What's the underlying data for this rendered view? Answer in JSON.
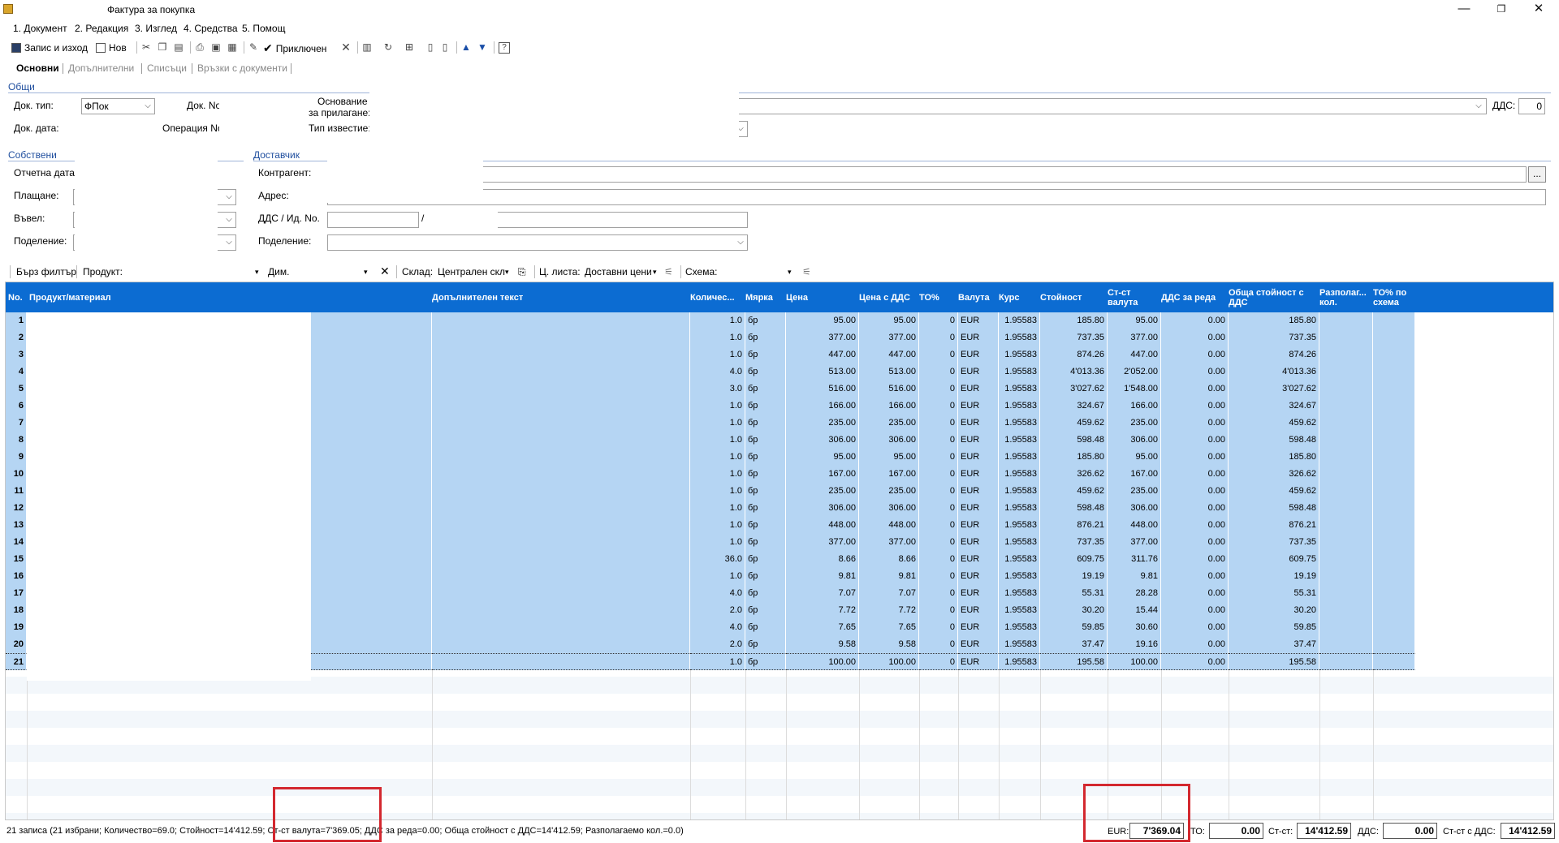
{
  "window": {
    "title": "Фактура за покупка",
    "minimize": "—",
    "restore": "❐",
    "close": "✕"
  },
  "menu": [
    "1. Документ",
    "2. Редакция",
    "3. Изглед",
    "4. Средства",
    "5. Помощ"
  ],
  "toolbar": {
    "save_exit": "Запис и изход",
    "new": "Нов",
    "finished": "Приключен"
  },
  "tabs": [
    "Основни",
    "Допълнителни",
    "Списъци",
    "Връзки с документи"
  ],
  "form": {
    "general_section": "Общи",
    "doc_type_label": "Док. тип:",
    "doc_type_value": "ФПок",
    "doc_no_label": "Док. No",
    "basis_label_1": "Основание",
    "basis_label_2": "за прилагане:",
    "vat_label": "ДДС:",
    "vat_value": "0",
    "doc_date_label": "Док. дата:",
    "operation_label": "Операция No",
    "notice_type_label": "Тип известие:",
    "own_section": "Собствени",
    "report_date_label": "Отчетна дата:",
    "payment_label": "Плащане:",
    "entered_label": "Въвел:",
    "division_label": "Поделение:",
    "supplier_section": "Доставчик",
    "counterparty_label": "Контрагент:",
    "address_label": "Адрес:",
    "vat_id_label": "ДДС / Ид. No.",
    "vat_id_sep": "/",
    "supplier_division_label": "Поделение:",
    "browse": "..."
  },
  "filter": {
    "quick": "Бърз филтър",
    "product": "Продукт:",
    "dim": "Дим.",
    "warehouse": "Склад:",
    "warehouse_value": "Централен скл",
    "price_list": "Ц. листа:",
    "price_list_value": "Доставни цени",
    "scheme": "Схема:"
  },
  "grid": {
    "headers": [
      "No.",
      "Продукт/материал",
      "Допълнителен текст",
      "Количес...",
      "Мярка",
      "Цена",
      "Цена с ДДС",
      "ТО%",
      "Валута",
      "Курс",
      "Стойност",
      "Ст-ст валута",
      "ДДС за реда",
      "Обща стойност с ДДС",
      "Разполаг... кол.",
      "ТО% по схема"
    ],
    "rows": [
      [
        "1",
        "1.0",
        "бр",
        "95.00",
        "95.00",
        "0",
        "EUR",
        "1.95583",
        "185.80",
        "95.00",
        "0.00",
        "185.80"
      ],
      [
        "2",
        "1.0",
        "бр",
        "377.00",
        "377.00",
        "0",
        "EUR",
        "1.95583",
        "737.35",
        "377.00",
        "0.00",
        "737.35"
      ],
      [
        "3",
        "1.0",
        "бр",
        "447.00",
        "447.00",
        "0",
        "EUR",
        "1.95583",
        "874.26",
        "447.00",
        "0.00",
        "874.26"
      ],
      [
        "4",
        "4.0",
        "бр",
        "513.00",
        "513.00",
        "0",
        "EUR",
        "1.95583",
        "4'013.36",
        "2'052.00",
        "0.00",
        "4'013.36"
      ],
      [
        "5",
        "3.0",
        "бр",
        "516.00",
        "516.00",
        "0",
        "EUR",
        "1.95583",
        "3'027.62",
        "1'548.00",
        "0.00",
        "3'027.62"
      ],
      [
        "6",
        "1.0",
        "бр",
        "166.00",
        "166.00",
        "0",
        "EUR",
        "1.95583",
        "324.67",
        "166.00",
        "0.00",
        "324.67"
      ],
      [
        "7",
        "1.0",
        "бр",
        "235.00",
        "235.00",
        "0",
        "EUR",
        "1.95583",
        "459.62",
        "235.00",
        "0.00",
        "459.62"
      ],
      [
        "8",
        "1.0",
        "бр",
        "306.00",
        "306.00",
        "0",
        "EUR",
        "1.95583",
        "598.48",
        "306.00",
        "0.00",
        "598.48"
      ],
      [
        "9",
        "1.0",
        "бр",
        "95.00",
        "95.00",
        "0",
        "EUR",
        "1.95583",
        "185.80",
        "95.00",
        "0.00",
        "185.80"
      ],
      [
        "10",
        "1.0",
        "бр",
        "167.00",
        "167.00",
        "0",
        "EUR",
        "1.95583",
        "326.62",
        "167.00",
        "0.00",
        "326.62"
      ],
      [
        "11",
        "1.0",
        "бр",
        "235.00",
        "235.00",
        "0",
        "EUR",
        "1.95583",
        "459.62",
        "235.00",
        "0.00",
        "459.62"
      ],
      [
        "12",
        "1.0",
        "бр",
        "306.00",
        "306.00",
        "0",
        "EUR",
        "1.95583",
        "598.48",
        "306.00",
        "0.00",
        "598.48"
      ],
      [
        "13",
        "1.0",
        "бр",
        "448.00",
        "448.00",
        "0",
        "EUR",
        "1.95583",
        "876.21",
        "448.00",
        "0.00",
        "876.21"
      ],
      [
        "14",
        "1.0",
        "бр",
        "377.00",
        "377.00",
        "0",
        "EUR",
        "1.95583",
        "737.35",
        "377.00",
        "0.00",
        "737.35"
      ],
      [
        "15",
        "36.0",
        "бр",
        "8.66",
        "8.66",
        "0",
        "EUR",
        "1.95583",
        "609.75",
        "311.76",
        "0.00",
        "609.75"
      ],
      [
        "16",
        "1.0",
        "бр",
        "9.81",
        "9.81",
        "0",
        "EUR",
        "1.95583",
        "19.19",
        "9.81",
        "0.00",
        "19.19"
      ],
      [
        "17",
        "4.0",
        "бр",
        "7.07",
        "7.07",
        "0",
        "EUR",
        "1.95583",
        "55.31",
        "28.28",
        "0.00",
        "55.31"
      ],
      [
        "18",
        "2.0",
        "бр",
        "7.72",
        "7.72",
        "0",
        "EUR",
        "1.95583",
        "30.20",
        "15.44",
        "0.00",
        "30.20"
      ],
      [
        "19",
        "4.0",
        "бр",
        "7.65",
        "7.65",
        "0",
        "EUR",
        "1.95583",
        "59.85",
        "30.60",
        "0.00",
        "59.85"
      ],
      [
        "20",
        "2.0",
        "бр",
        "9.58",
        "9.58",
        "0",
        "EUR",
        "1.95583",
        "37.47",
        "19.16",
        "0.00",
        "37.47"
      ],
      [
        "21",
        "1.0",
        "бр",
        "100.00",
        "100.00",
        "0",
        "EUR",
        "1.95583",
        "195.58",
        "100.00",
        "0.00",
        "195.58"
      ]
    ]
  },
  "status": {
    "summary": "21 записа (21 избрани; Количество=69.0; Стойност=14'412.59; Ст-ст валута=7'369.05; ДДС за реда=0.00; Обща стойност с ДДС=14'412.59; Разполагаемо кол.=0.0)",
    "eur_label": "EUR:",
    "eur_value": "7'369.04",
    "to_label": "ТО:",
    "to_value": "0.00",
    "value_label": "Ст-ст:",
    "value_value": "14'412.59",
    "vat_label": "ДДС:",
    "vat_value": "0.00",
    "total_label": "Ст-ст с ДДС:",
    "total_value": "14'412.59"
  },
  "colors": {
    "header_bg": "#0c6cd2",
    "row_selected": "#b5d5f3",
    "highlight_box": "#d3282f",
    "section_text": "#1f4e9e"
  }
}
